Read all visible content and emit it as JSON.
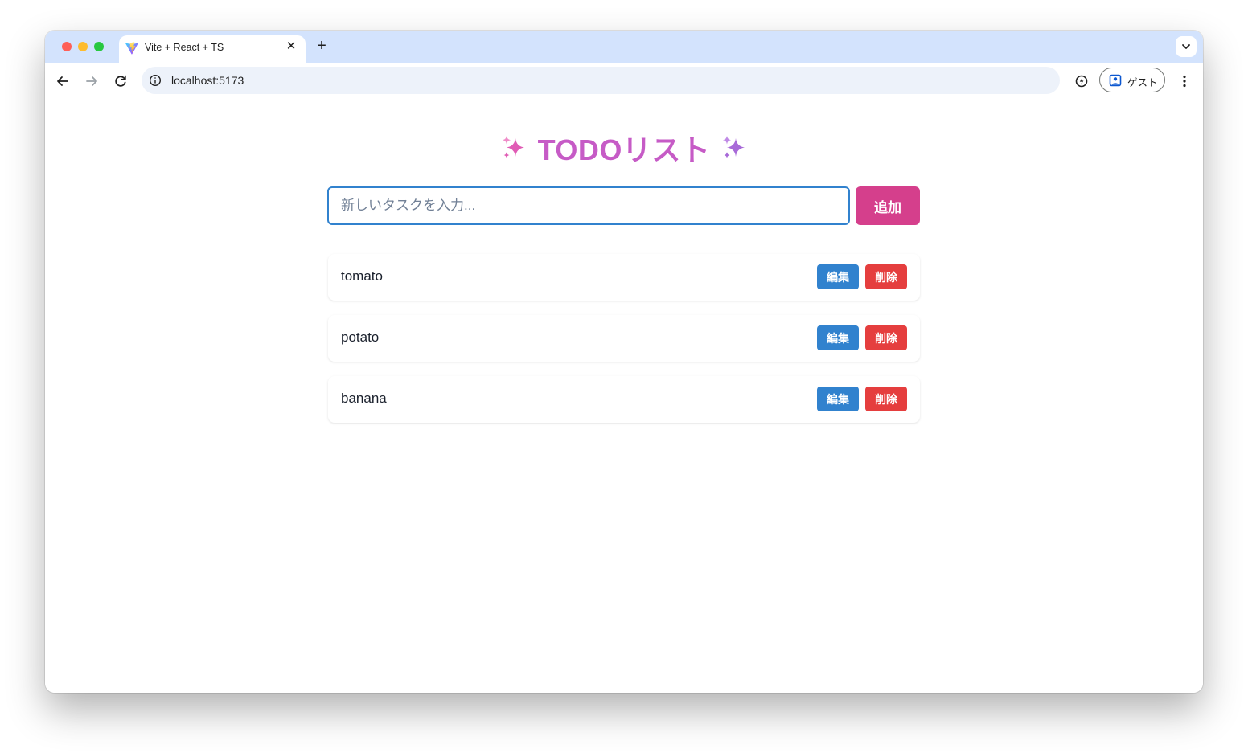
{
  "browser": {
    "tab": {
      "title": "Vite + React + TS",
      "favicon": "vite-logo-icon",
      "close_icon": "close-icon"
    },
    "new_tab_icon": "plus-icon",
    "tab_search_icon": "chevron-down-icon",
    "toolbar": {
      "back_icon": "arrow-left-icon",
      "forward_icon": "arrow-right-icon",
      "reload_icon": "reload-icon",
      "site_info_icon": "info-icon",
      "url": "localhost:5173",
      "performance_icon": "performance-icon",
      "profile_label": "ゲスト",
      "profile_icon": "person-icon",
      "menu_icon": "more-vertical-icon"
    }
  },
  "app": {
    "title": "TODOリスト",
    "title_decoration_icon": "sparkles-icon",
    "input": {
      "placeholder": "新しいタスクを入力...",
      "value": ""
    },
    "add_button_label": "追加",
    "todos": [
      {
        "text": "tomato",
        "edit_label": "編集",
        "delete_label": "削除"
      },
      {
        "text": "potato",
        "edit_label": "編集",
        "delete_label": "削除"
      },
      {
        "text": "banana",
        "edit_label": "編集",
        "delete_label": "削除"
      }
    ],
    "colors": {
      "title": "#c65bc6",
      "add_button": "#d53f8c",
      "edit_button": "#3182ce",
      "delete_button": "#e53e3e",
      "input_border": "#3182ce"
    }
  }
}
